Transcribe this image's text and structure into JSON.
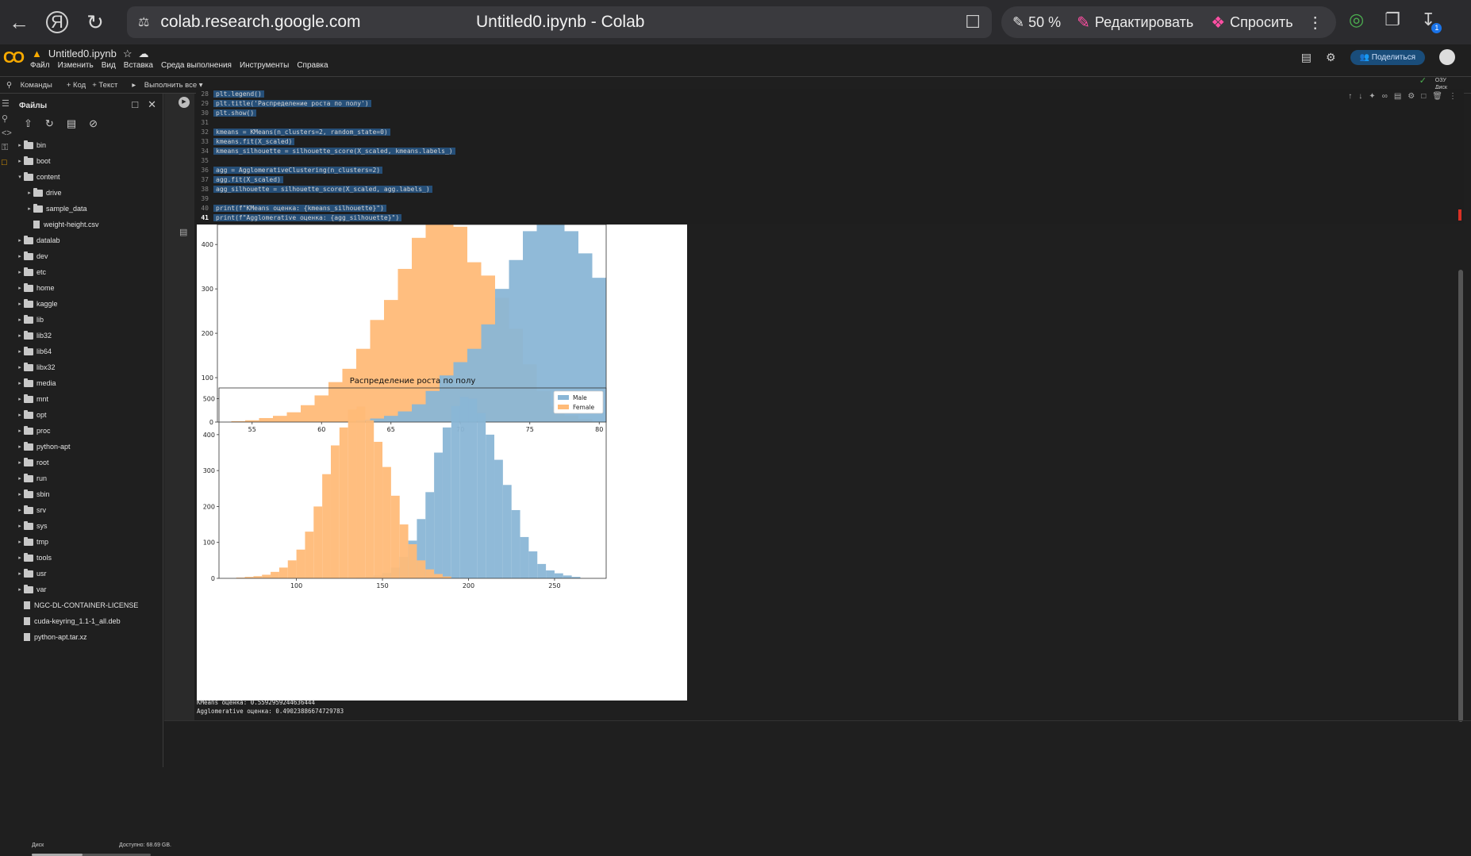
{
  "browser": {
    "url": "colab.research.google.com",
    "page_title": "Untitled0.ipynb - Colab",
    "zoom": "50 %",
    "edit_label": "Редактировать",
    "ask_label": "Спросить",
    "download_badge": "1"
  },
  "colab": {
    "notebook_name": "Untitled0.ipynb",
    "menu": [
      "Файл",
      "Изменить",
      "Вид",
      "Вставка",
      "Среда выполнения",
      "Инструменты",
      "Справка"
    ],
    "share_label": "Поделиться",
    "toolbar": {
      "commands": "Команды",
      "code": "+ Код",
      "text": "+ Текст",
      "run_all": "Выполнить все"
    },
    "ram_label": "ОЗУ",
    "disk_label": "Диск"
  },
  "files_panel": {
    "title": "Файлы",
    "items": [
      {
        "name": "bin",
        "type": "folder",
        "depth": 0,
        "expanded": false
      },
      {
        "name": "boot",
        "type": "folder",
        "depth": 0,
        "expanded": false
      },
      {
        "name": "content",
        "type": "folder",
        "depth": 0,
        "expanded": true
      },
      {
        "name": "drive",
        "type": "folder",
        "depth": 1,
        "expanded": false
      },
      {
        "name": "sample_data",
        "type": "folder",
        "depth": 1,
        "expanded": false
      },
      {
        "name": "weight-height.csv",
        "type": "file",
        "depth": 1
      },
      {
        "name": "datalab",
        "type": "folder",
        "depth": 0,
        "expanded": false
      },
      {
        "name": "dev",
        "type": "folder",
        "depth": 0,
        "expanded": false
      },
      {
        "name": "etc",
        "type": "folder",
        "depth": 0,
        "expanded": false
      },
      {
        "name": "home",
        "type": "folder",
        "depth": 0,
        "expanded": false
      },
      {
        "name": "kaggle",
        "type": "folder",
        "depth": 0,
        "expanded": false
      },
      {
        "name": "lib",
        "type": "folder",
        "depth": 0,
        "expanded": false
      },
      {
        "name": "lib32",
        "type": "folder",
        "depth": 0,
        "expanded": false
      },
      {
        "name": "lib64",
        "type": "folder",
        "depth": 0,
        "expanded": false
      },
      {
        "name": "libx32",
        "type": "folder",
        "depth": 0,
        "expanded": false
      },
      {
        "name": "media",
        "type": "folder",
        "depth": 0,
        "expanded": false
      },
      {
        "name": "mnt",
        "type": "folder",
        "depth": 0,
        "expanded": false
      },
      {
        "name": "opt",
        "type": "folder",
        "depth": 0,
        "expanded": false
      },
      {
        "name": "proc",
        "type": "folder",
        "depth": 0,
        "expanded": false
      },
      {
        "name": "python-apt",
        "type": "folder",
        "depth": 0,
        "expanded": false
      },
      {
        "name": "root",
        "type": "folder",
        "depth": 0,
        "expanded": false
      },
      {
        "name": "run",
        "type": "folder",
        "depth": 0,
        "expanded": false
      },
      {
        "name": "sbin",
        "type": "folder",
        "depth": 0,
        "expanded": false
      },
      {
        "name": "srv",
        "type": "folder",
        "depth": 0,
        "expanded": false
      },
      {
        "name": "sys",
        "type": "folder",
        "depth": 0,
        "expanded": false
      },
      {
        "name": "tmp",
        "type": "folder",
        "depth": 0,
        "expanded": false
      },
      {
        "name": "tools",
        "type": "folder",
        "depth": 0,
        "expanded": false
      },
      {
        "name": "usr",
        "type": "folder",
        "depth": 0,
        "expanded": false
      },
      {
        "name": "var",
        "type": "folder",
        "depth": 0,
        "expanded": false
      },
      {
        "name": "NGC-DL-CONTAINER-LICENSE",
        "type": "file",
        "depth": 0
      },
      {
        "name": "cuda-keyring_1.1-1_all.deb",
        "type": "file",
        "depth": 0
      },
      {
        "name": "python-apt.tar.xz",
        "type": "file",
        "depth": 0
      }
    ],
    "disk_label": "Диск",
    "disk_available": "Доступно: 68.69 GB."
  },
  "code_cell": {
    "lines": [
      {
        "n": "28",
        "text": "plt.legend()",
        "selected": true
      },
      {
        "n": "29",
        "text": "plt.title('Распределение роста по полу')",
        "selected": true
      },
      {
        "n": "30",
        "text": "plt.show()",
        "selected": true
      },
      {
        "n": "31",
        "text": "",
        "selected": true
      },
      {
        "n": "32",
        "text": "kmeans = KMeans(n_clusters=2, random_state=0)",
        "selected": true
      },
      {
        "n": "33",
        "text": "kmeans.fit(X_scaled)",
        "selected": true
      },
      {
        "n": "34",
        "text": "kmeans_silhouette = silhouette_score(X_scaled, kmeans.labels_)",
        "selected": true
      },
      {
        "n": "35",
        "text": "",
        "selected": true
      },
      {
        "n": "36",
        "text": "agg = AgglomerativeClustering(n_clusters=2)",
        "selected": true
      },
      {
        "n": "37",
        "text": "agg.fit(X_scaled)",
        "selected": true
      },
      {
        "n": "38",
        "text": "agg_silhouette = silhouette_score(X_scaled, agg.labels_)",
        "selected": true
      },
      {
        "n": "39",
        "text": "",
        "selected": true
      },
      {
        "n": "40",
        "text": "print(f\"KMeans оценка: {kmeans_silhouette}\")",
        "selected": true
      },
      {
        "n": "41",
        "text": "print(f\"Agglomerative оценка: {agg_silhouette}\")",
        "selected": true
      }
    ]
  },
  "console_output": [
    "KMeans оценка: 0.5592959244636444",
    "Agglomerative оценка: 0.49023886674729783"
  ],
  "chart_data": [
    {
      "type": "bar",
      "title": "",
      "xlabel": "",
      "ylabel": "",
      "xlim": [
        52.5,
        80.5
      ],
      "ylim": [
        0,
        445
      ],
      "xticks": [
        "55",
        "60",
        "65",
        "70",
        "75",
        "80"
      ],
      "yticks": [
        "0",
        "100",
        "200",
        "300",
        "400"
      ],
      "bin_width": 1,
      "series": [
        {
          "name": "",
          "color": "#ffbb78",
          "bin_start": 53.5,
          "values": [
            2,
            4,
            9,
            14,
            22,
            38,
            60,
            90,
            120,
            165,
            230,
            275,
            345,
            415,
            470,
            480,
            440,
            360,
            330,
            280,
            210,
            130,
            70,
            35,
            15,
            7
          ]
        },
        {
          "name": "",
          "color": "#8ab6d6",
          "bin_start": 62.5,
          "values": [
            4,
            8,
            14,
            24,
            40,
            70,
            105,
            135,
            165,
            220,
            300,
            365,
            430,
            470,
            480,
            430,
            380,
            325,
            275,
            235,
            160,
            110,
            70,
            40,
            25,
            12
          ]
        }
      ]
    },
    {
      "type": "bar",
      "title": "Распределение роста по полу",
      "xlabel": "",
      "ylabel": "",
      "xlim": [
        55,
        280
      ],
      "ylim": [
        0,
        530
      ],
      "xticks": [
        "100",
        "150",
        "200",
        "250"
      ],
      "yticks": [
        "0",
        "100",
        "200",
        "300",
        "400",
        "500"
      ],
      "legend": "top-right",
      "series": [
        {
          "name": "Male",
          "color": "#8ab6d6",
          "bin_start": 135,
          "bin_width": 5,
          "values": [
            2,
            4,
            8,
            15,
            30,
            60,
            105,
            165,
            240,
            350,
            420,
            480,
            505,
            500,
            460,
            400,
            330,
            260,
            190,
            115,
            75,
            40,
            22,
            14,
            8,
            4
          ]
        },
        {
          "name": "Female",
          "color": "#ffbb78",
          "bin_start": 65,
          "bin_width": 5,
          "values": [
            2,
            4,
            6,
            10,
            18,
            30,
            50,
            80,
            130,
            200,
            290,
            370,
            420,
            470,
            478,
            440,
            380,
            310,
            230,
            150,
            95,
            50,
            25,
            12,
            5
          ]
        }
      ]
    }
  ]
}
